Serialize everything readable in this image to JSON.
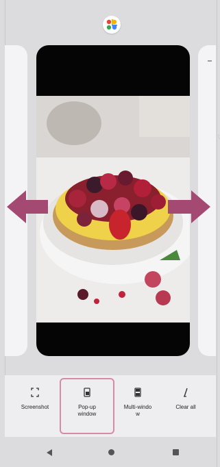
{
  "app": {
    "icon": "google-photos-pinwheel-icon"
  },
  "recents": {
    "center_card": {
      "content": "berry-tart-photo"
    }
  },
  "actions": [
    {
      "label": "Screenshot",
      "icon": "screenshot-icon"
    },
    {
      "label": "Pop-up\nwindow",
      "icon": "popup-window-icon"
    },
    {
      "label": "Multi-windo\nw",
      "icon": "multi-window-icon"
    },
    {
      "label": "Clear all",
      "icon": "clear-all-icon"
    }
  ],
  "navigation": {
    "back": "back-icon",
    "home": "home-icon",
    "recents": "recents-icon"
  },
  "colors": {
    "highlight": "#d68aa6",
    "arrow": "#a44a72"
  }
}
